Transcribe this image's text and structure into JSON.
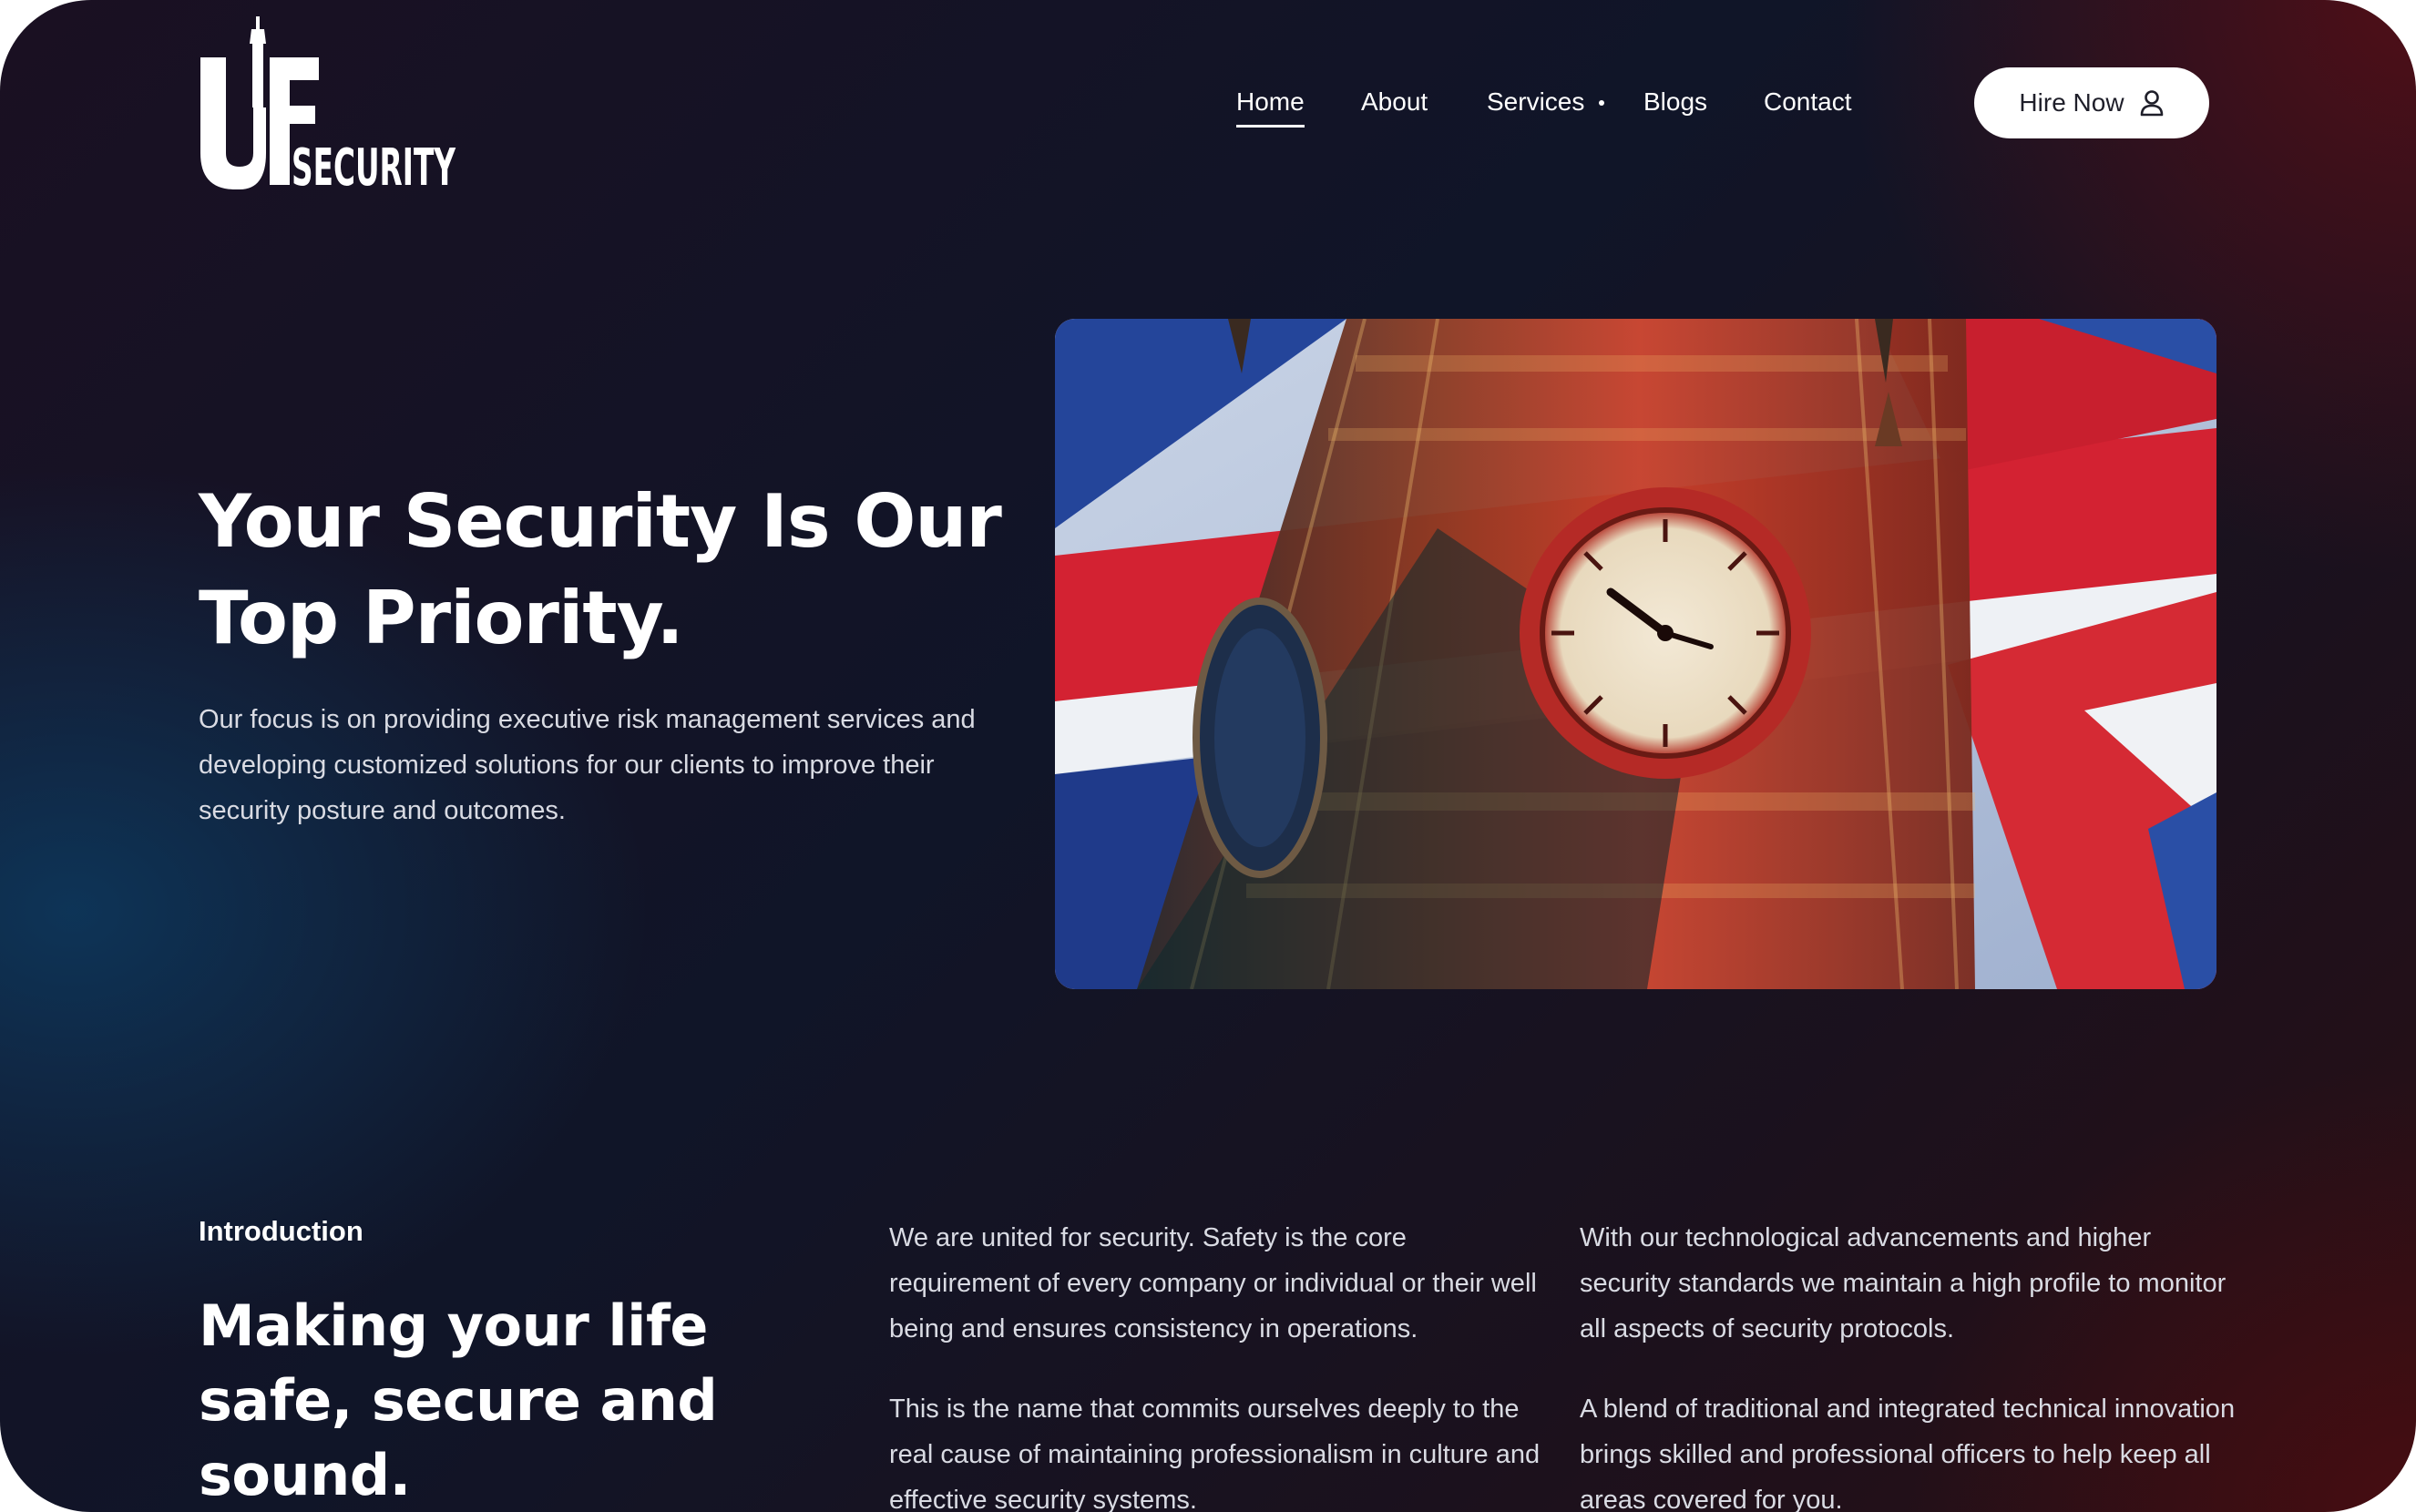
{
  "brand": {
    "logo_text": "UFSECURITY",
    "logo_letters": "UF",
    "logo_word": "SECURITY"
  },
  "nav": {
    "items": [
      {
        "label": "Home",
        "active": true
      },
      {
        "label": "About",
        "active": false
      },
      {
        "label": "Services",
        "active": false,
        "has_dropdown": true
      },
      {
        "label": "Blogs",
        "active": false
      },
      {
        "label": "Contact",
        "active": false
      }
    ],
    "cta_label": "Hire Now",
    "cta_icon": "user-icon"
  },
  "hero": {
    "title": "Your Security Is Our Top Priority.",
    "description": "Our focus is on providing executive risk management services and developing customized solutions for our clients to improve their security posture and outcomes.",
    "image": "big-ben-union-flag-photo"
  },
  "intro": {
    "label": "Introduction",
    "title": "Making your life safe, secure and sound.",
    "column_1": [
      "We are united for security. Safety is the core requirement of every company or individual or their well being and ensures consistency in operations.",
      "This is the name that commits ourselves deeply to the real cause of maintaining professionalism in culture and effective security systems."
    ],
    "column_2": [
      "With our technological advancements and higher security standards we maintain a high profile to monitor all aspects of security protocols.",
      "A blend of traditional and integrated technical innovation brings skilled and professional officers to help keep all areas covered for you."
    ]
  },
  "colors": {
    "background_dark": "#101528",
    "accent_red": "#c8202c",
    "accent_blue": "#1f3d8f",
    "text_light": "#d9dbe3",
    "button_bg": "#ffffff"
  }
}
